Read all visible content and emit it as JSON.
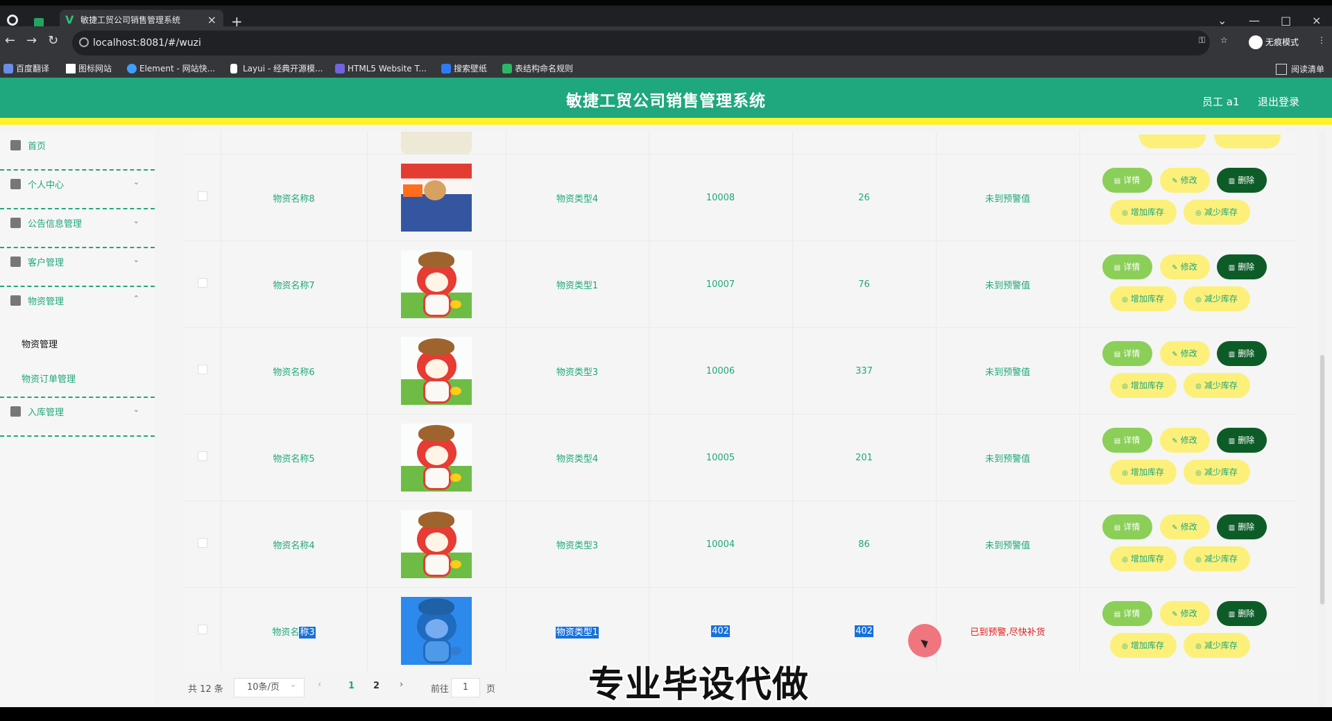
{
  "browser": {
    "tab_title": "敏捷工贸公司销售管理系统",
    "url": "localhost:8081/#/wuzi",
    "incognito_label": "无痕模式",
    "bookmarks": [
      "百度翻译",
      "图标网站",
      "Element - 网站快...",
      "Layui - 经典开源模...",
      "HTML5 Website T...",
      "搜索壁纸",
      "表结构命名规则"
    ],
    "read_list": "阅读清单",
    "icons": {
      "logo": "vue-logo-icon",
      "close": "close-icon",
      "new_tab": "plus-icon"
    }
  },
  "header": {
    "title": "敏捷工贸公司销售管理系统",
    "user": "员工 a1",
    "logout": "退出登录"
  },
  "sidebar": {
    "items": [
      {
        "label": "首页"
      },
      {
        "label": "个人中心"
      },
      {
        "label": "公告信息管理"
      },
      {
        "label": "客户管理"
      },
      {
        "label": "物资管理"
      },
      {
        "label": "入库管理"
      }
    ],
    "submenu": [
      {
        "label": "物资管理"
      },
      {
        "label": "物资订单管理"
      }
    ]
  },
  "table": {
    "actions": {
      "detail": "详情",
      "edit": "修改",
      "delete": "删除",
      "add_stock": "增加库存",
      "reduce_stock": "减少库存"
    },
    "rows": [
      {
        "name": "物资名称8",
        "type": "物资类型4",
        "code": "10008",
        "stock": "26",
        "warning": "未到预警值"
      },
      {
        "name": "物资名称7",
        "type": "物资类型1",
        "code": "10007",
        "stock": "76",
        "warning": "未到预警值"
      },
      {
        "name": "物资名称6",
        "type": "物资类型3",
        "code": "10006",
        "stock": "337",
        "warning": "未到预警值"
      },
      {
        "name": "物资名称5",
        "type": "物资类型4",
        "code": "10005",
        "stock": "201",
        "warning": "未到预警值"
      },
      {
        "name": "物资名称4",
        "type": "物资类型3",
        "code": "10004",
        "stock": "86",
        "warning": "未到预警值"
      },
      {
        "name_prefix": "物资名",
        "name_selected": "称3",
        "type": "物资类型1",
        "code": "402",
        "stock": "402",
        "warning": "已到预警,尽快补货"
      }
    ]
  },
  "pagination": {
    "total": "共 12 条",
    "page_size": "10条/页",
    "page_1": "1",
    "page_2": "2",
    "goto_label": "前往",
    "goto_value": "1",
    "page_unit": "页"
  },
  "overlay": {
    "watermark": "专业毕设代做"
  },
  "colors": {
    "theme": "#1fa77d",
    "accent": "#fff02b",
    "danger": "#e02020"
  }
}
